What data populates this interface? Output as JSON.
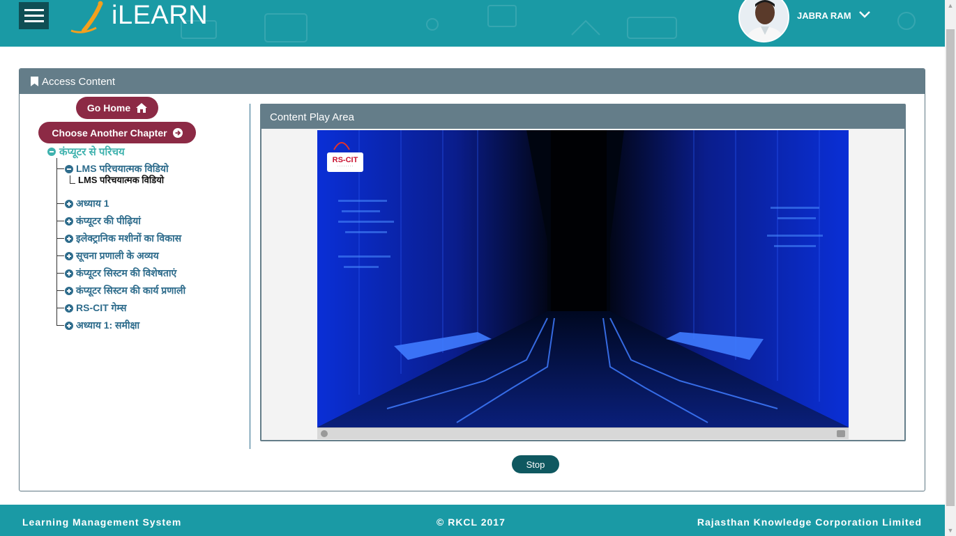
{
  "header": {
    "logo_text": "iLEARN",
    "user_name": "JABRA RAM"
  },
  "panel": {
    "title": "Access Content",
    "go_home_label": "Go Home",
    "choose_chapter_label": "Choose Another Chapter",
    "tree": {
      "root": "कंप्यूटर से परिचय",
      "lms_item": "LMS परिचयात्मक विडियो",
      "lms_leaf": "LMS परिचयात्मक विडियो",
      "items": [
        "अध्याय 1",
        "कंप्यूटर की पीढ़ियां",
        "इलेक्ट्रानिक मशीनों का विकास",
        "सूचना प्रणाली के अव्यय",
        "कंप्यूटर सिस्टम की विशेषताएं",
        "कंप्यूटर सिस्टम की कार्य प्रणाली",
        "RS-CIT गेम्स",
        "अध्याय 1: समीक्षा"
      ]
    },
    "play_area_title": "Content Play Area",
    "video_logo_text": "RS-CIT",
    "stop_label": "Stop"
  },
  "footer": {
    "left": "Learning Management System",
    "center": "© RKCL 2017",
    "right": "Rajasthan Knowledge Corporation Limited"
  },
  "colors": {
    "header_teal": "#1a9aa5",
    "panel_header": "#647d89",
    "button_maroon": "#8c2a45",
    "stop_button": "#0f5860",
    "tree_root": "#3fb2ae",
    "tree_item": "#2e6c8c"
  },
  "icons": {
    "menu": "hamburger-menu-icon",
    "user_dropdown": "chevron-down-icon",
    "panel": "bookmark-icon",
    "home": "home-icon",
    "chapter": "arrow-circle-right-icon",
    "collapse": "minus-circle-icon",
    "expand": "plus-circle-icon"
  }
}
